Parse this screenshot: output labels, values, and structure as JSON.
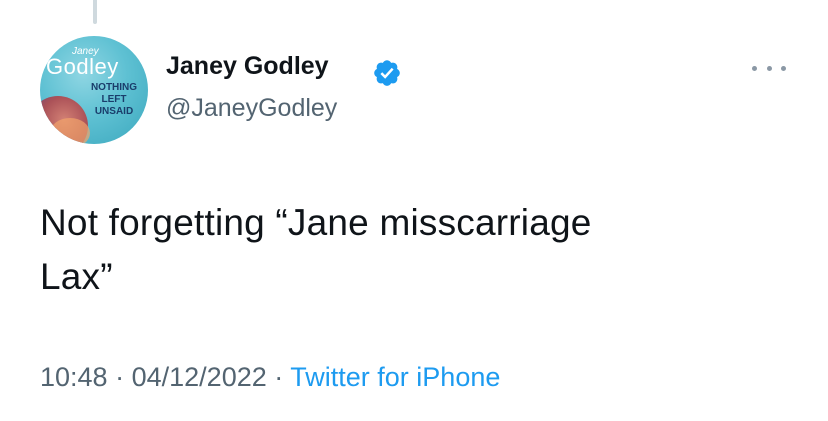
{
  "tweet": {
    "author": {
      "display_name": "Janey Godley",
      "handle": "@JaneyGodley",
      "verified_icon": "verified-badge-icon",
      "avatar": {
        "small_text": "Janey",
        "big_text": "Godley",
        "tagline": [
          "NOTHING",
          "LEFT",
          "UNSAID"
        ]
      }
    },
    "text_line1": "Not forgetting “Jane misscarriage",
    "text_line2": "Lax”",
    "time": "10:48",
    "date": "04/12/2022",
    "separator": "·",
    "source": "Twitter for iPhone",
    "more_icon": "more-horizontal-icon"
  },
  "colors": {
    "verified": "#1d9bf0",
    "link": "#1d9bf0",
    "secondary_text": "#536471",
    "primary_text": "#0f1419"
  }
}
